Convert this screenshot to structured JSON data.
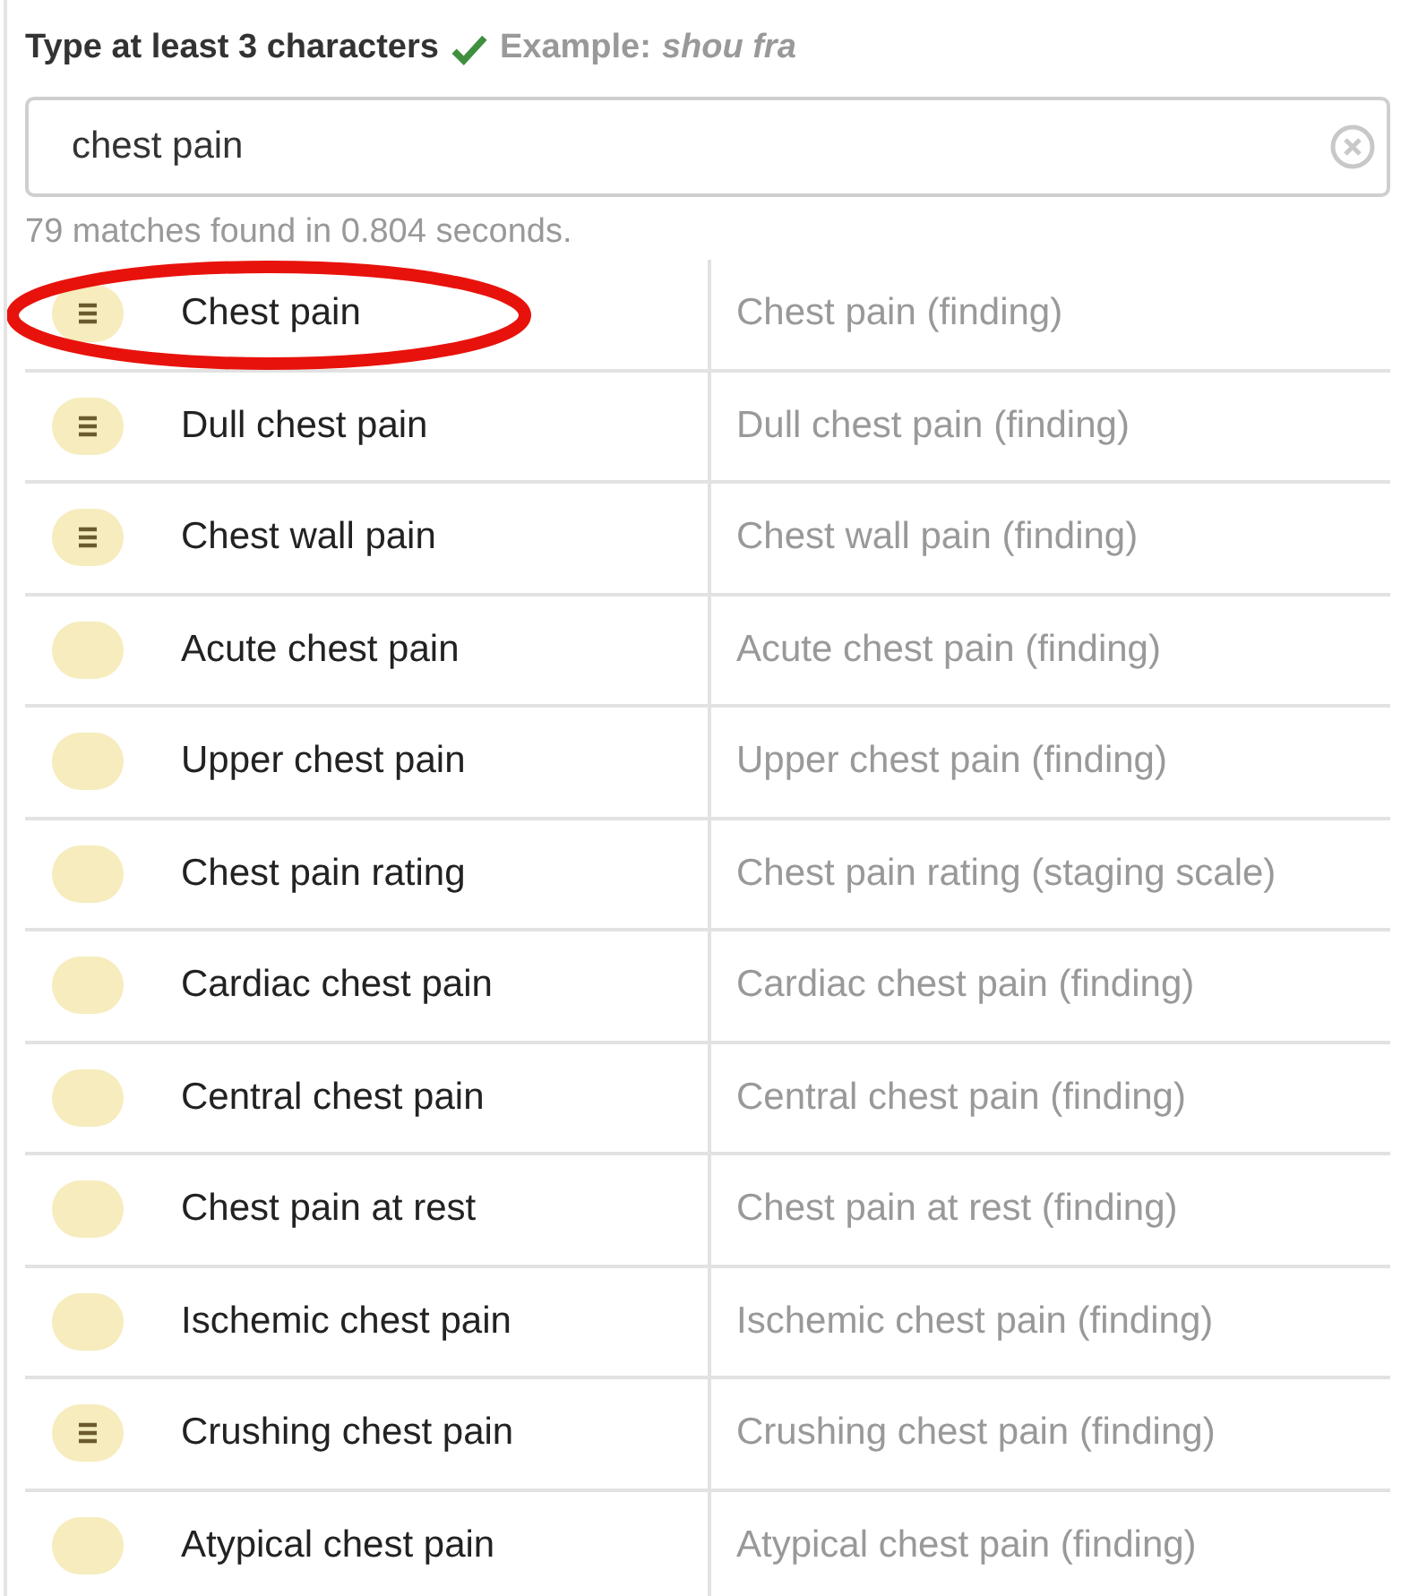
{
  "prompt": {
    "instruction": "Type at least 3 characters",
    "valid": true,
    "example_label": "Example:",
    "example_value": "shou fra"
  },
  "search": {
    "value": "chest pain"
  },
  "status": "79 matches found in 0.804 seconds.",
  "results": [
    {
      "term": "Chest pain",
      "description": "Chest pain (finding)",
      "has_details": true,
      "circled": true
    },
    {
      "term": "Dull chest pain",
      "description": "Dull chest pain (finding)",
      "has_details": true,
      "circled": false
    },
    {
      "term": "Chest wall pain",
      "description": "Chest wall pain (finding)",
      "has_details": true,
      "circled": false
    },
    {
      "term": "Acute chest pain",
      "description": "Acute chest pain (finding)",
      "has_details": false,
      "circled": false
    },
    {
      "term": "Upper chest pain",
      "description": "Upper chest pain (finding)",
      "has_details": false,
      "circled": false
    },
    {
      "term": "Chest pain rating",
      "description": "Chest pain rating (staging scale)",
      "has_details": false,
      "circled": false
    },
    {
      "term": "Cardiac chest pain",
      "description": "Cardiac chest pain (finding)",
      "has_details": false,
      "circled": false
    },
    {
      "term": "Central chest pain",
      "description": "Central chest pain (finding)",
      "has_details": false,
      "circled": false
    },
    {
      "term": "Chest pain at rest",
      "description": "Chest pain at rest (finding)",
      "has_details": false,
      "circled": false
    },
    {
      "term": "Ischemic chest pain",
      "description": "Ischemic chest pain (finding)",
      "has_details": false,
      "circled": false
    },
    {
      "term": "Crushing chest pain",
      "description": "Crushing chest pain (finding)",
      "has_details": true,
      "circled": false
    },
    {
      "term": "Atypical chest pain",
      "description": "Atypical chest pain (finding)",
      "has_details": false,
      "circled": false
    }
  ]
}
